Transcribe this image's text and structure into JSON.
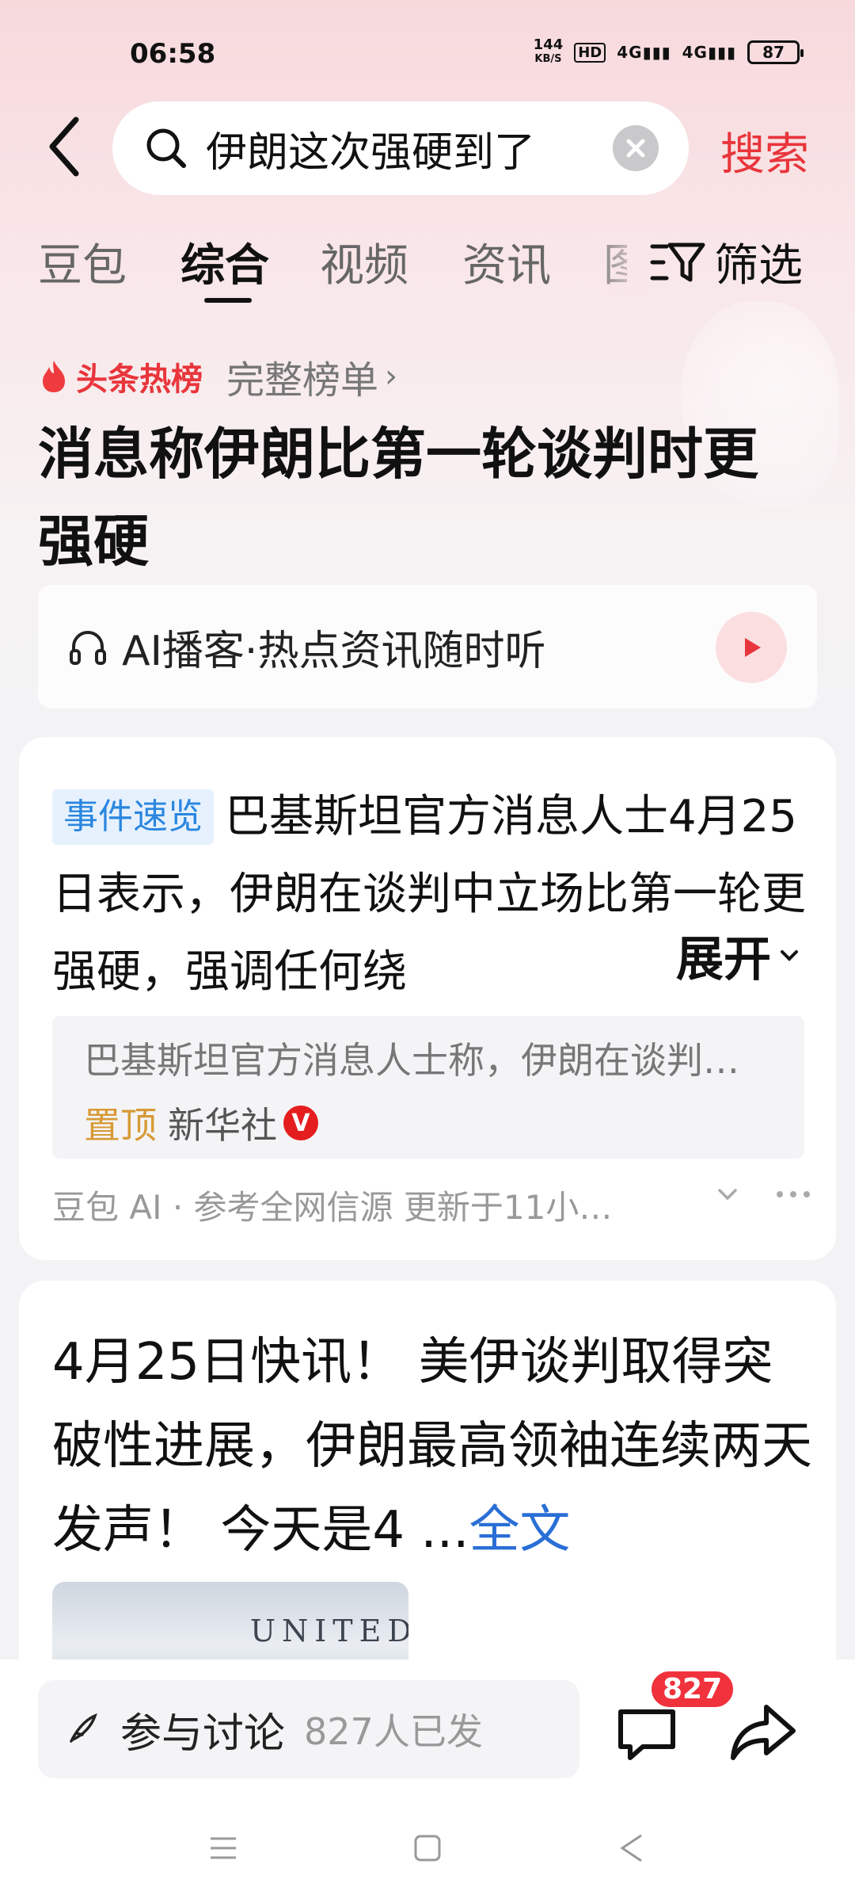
{
  "status_bar": {
    "time": "06:58",
    "net_speed_value": "144",
    "net_speed_unit": "KB/S",
    "hd": "HD",
    "signal1": "4G",
    "signal2": "4G",
    "battery": "87"
  },
  "search": {
    "query": "伊朗这次强硬到了",
    "button": "搜索"
  },
  "tabs": [
    "豆包",
    "综合",
    "视频",
    "资讯",
    "图"
  ],
  "active_tab": "综合",
  "filter_label": "筛选",
  "hot": {
    "label": "头条热榜",
    "full_list": "完整榜单",
    "headline": "消息称伊朗比第一轮谈判时更强硬"
  },
  "podcast": {
    "label": "AI播客·热点资讯随时听"
  },
  "card1": {
    "tag": "事件速览",
    "body": "巴基斯坦官方消息人士4月25日表示，伊朗在谈判中立场比第一轮更强硬，强调任何绕",
    "expand": "展开",
    "source_summary": "巴基斯坦官方消息人士称，伊朗在谈判…",
    "pinned": "置顶",
    "publisher": "新华社",
    "verified": "V",
    "footer": "豆包 AI · 参考全网信源 更新于11小…"
  },
  "card2": {
    "body": "4月25日快讯！ 美伊谈判取得突破性进展，伊朗最高领袖连续两天发声！ 今天是4 ...",
    "full_text": "全文",
    "thumb_text": "UNITED"
  },
  "bottom": {
    "discuss": "参与讨论",
    "discuss_count": "827人已发",
    "comment_badge": "827"
  },
  "colors": {
    "accent_red": "#e8353b",
    "link_blue": "#2a6fd6",
    "tag_blue": "#2a86e0",
    "pin_gold": "#d79a36"
  }
}
